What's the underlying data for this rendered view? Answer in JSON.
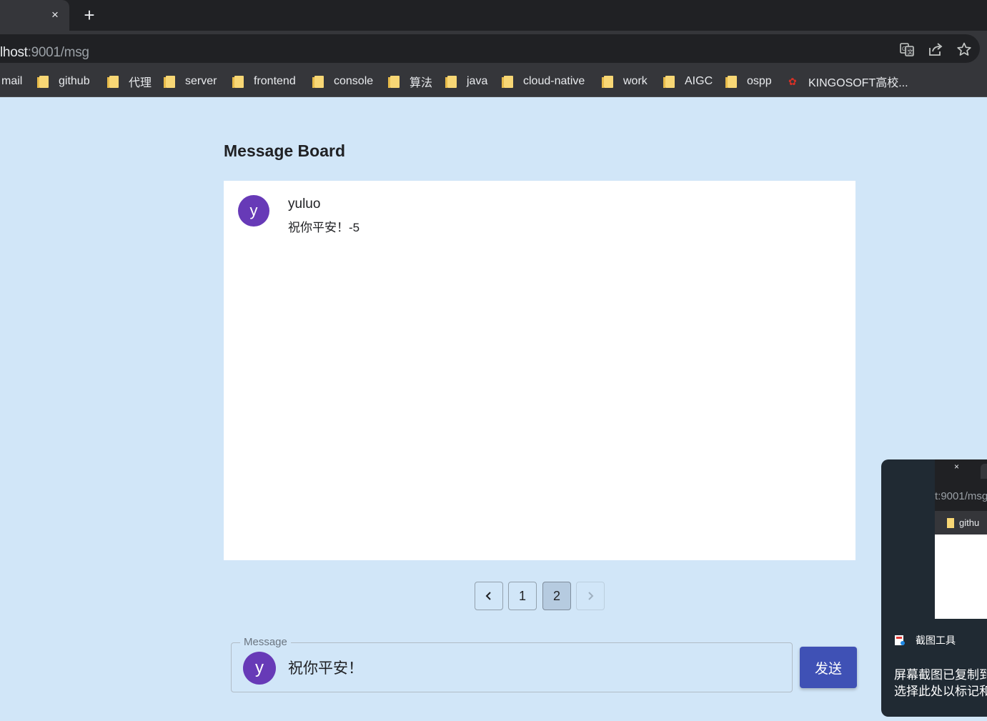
{
  "browser": {
    "tab_close_symbol": "×",
    "new_tab_symbol": "+",
    "url_host": "lhost",
    "url_rest": ":9001/msg",
    "icons": [
      "translate-icon",
      "share-icon",
      "star-icon"
    ],
    "bookmarks": [
      "mail",
      "github",
      "代理",
      "server",
      "frontend",
      "console",
      "算法",
      "java",
      "cloud-native",
      "work",
      "AIGC",
      "ospp",
      "KINGOSOFT高校..."
    ]
  },
  "page": {
    "title": "Message Board",
    "messages": [
      {
        "avatar_letter": "y",
        "name": "yuluo",
        "text": "祝你平安！-5"
      }
    ],
    "pagination": {
      "prev_symbol": "‹",
      "next_symbol": "›",
      "pages": [
        "1",
        "2"
      ],
      "current_page": "2",
      "next_disabled": true
    },
    "composer": {
      "label": "Message",
      "avatar_letter": "y",
      "value": "祝你平安！",
      "send_label": "发送"
    }
  },
  "notification": {
    "thumbnail": {
      "close_symbol": "×",
      "url": "t:9001/msg",
      "bookmark": "githu"
    },
    "app_name": "截图工具",
    "line1": "屏幕截图已复制到",
    "line2": "选择此处以标记和"
  },
  "colors": {
    "page_bg": "#d1e6f8",
    "avatar": "#673ab7",
    "send_button": "#3f51b5",
    "selected_page": "#b6cbe0"
  }
}
